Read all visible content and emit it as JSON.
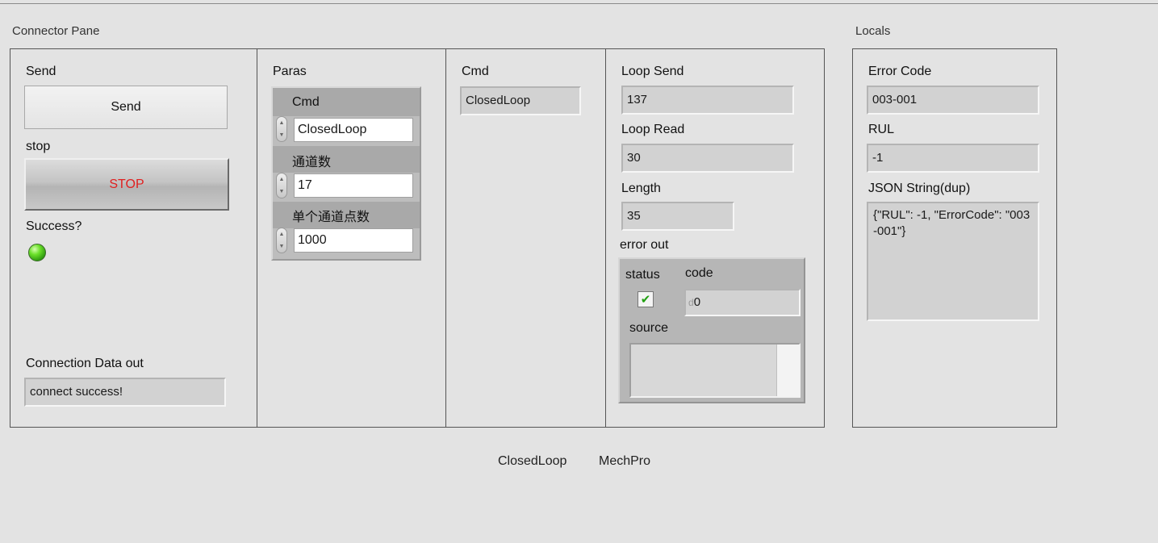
{
  "connector_pane": {
    "title": "Connector Pane",
    "send": {
      "label": "Send",
      "button_text": "Send"
    },
    "stop": {
      "label": "stop",
      "button_text": "STOP",
      "text_color": "#e02020"
    },
    "success": {
      "label": "Success?",
      "led_on": true,
      "led_color": "#5fd626"
    },
    "connection_data_out": {
      "label": "Connection Data out",
      "value": "connect success!"
    },
    "paras": {
      "label": "Paras",
      "cmd_label": "Cmd",
      "cmd_value": "ClosedLoop",
      "channels_label": "通道数",
      "channels_value": "17",
      "points_label": "单个通道点数",
      "points_value": "1000"
    },
    "cmd": {
      "label": "Cmd",
      "value": "ClosedLoop"
    },
    "loop_send": {
      "label": "Loop Send",
      "value": "137"
    },
    "loop_read": {
      "label": "Loop Read",
      "value": "30"
    },
    "length": {
      "label": "Length",
      "value": "35"
    },
    "error_out": {
      "label": "error out",
      "status_label": "status",
      "status_checked": true,
      "code_label": "code",
      "code_radix": "d",
      "code_value": "0",
      "source_label": "source",
      "source_value": ""
    }
  },
  "locals": {
    "title": "Locals",
    "error_code": {
      "label": "Error Code",
      "value": "003-001"
    },
    "rul": {
      "label": "RUL",
      "value": "-1"
    },
    "json_string": {
      "label": "JSON String(dup)",
      "value": "{\"RUL\": -1, \"ErrorCode\": \"003-001\"}"
    }
  },
  "footer": {
    "left": "ClosedLoop",
    "right": "MechPro"
  }
}
